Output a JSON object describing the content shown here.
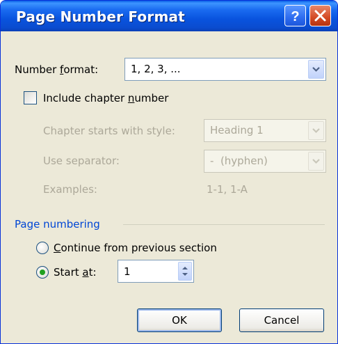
{
  "dialog": {
    "title": "Page Number Format",
    "help_button": "?",
    "close_button": "X"
  },
  "number_format": {
    "label_pre": "Number ",
    "label_u": "f",
    "label_post": "ormat:",
    "value": "1, 2, 3, ..."
  },
  "include_chapter": {
    "label_pre": "Include chapter ",
    "label_u": "n",
    "label_post": "umber",
    "checked": false
  },
  "chapter_style": {
    "label": "Chapter starts with style:",
    "value": "Heading 1",
    "enabled": false
  },
  "separator": {
    "label": "Use separator:",
    "value": "-  (hyphen)",
    "enabled": false
  },
  "examples": {
    "label": "Examples:",
    "value": "1-1, 1-A"
  },
  "page_numbering": {
    "group_label": "Page numbering",
    "continue": {
      "label_u": "C",
      "label_post": "ontinue from previous section",
      "selected": false
    },
    "start_at": {
      "label_pre": "Start ",
      "label_u": "a",
      "label_post": "t:",
      "selected": true,
      "value": "1"
    }
  },
  "buttons": {
    "ok": "OK",
    "cancel": "Cancel"
  },
  "colors": {
    "titlebar": "#0a53de",
    "group_label": "#0046d5",
    "dialog_bg": "#ece9d8",
    "disabled_text": "#aca899"
  }
}
